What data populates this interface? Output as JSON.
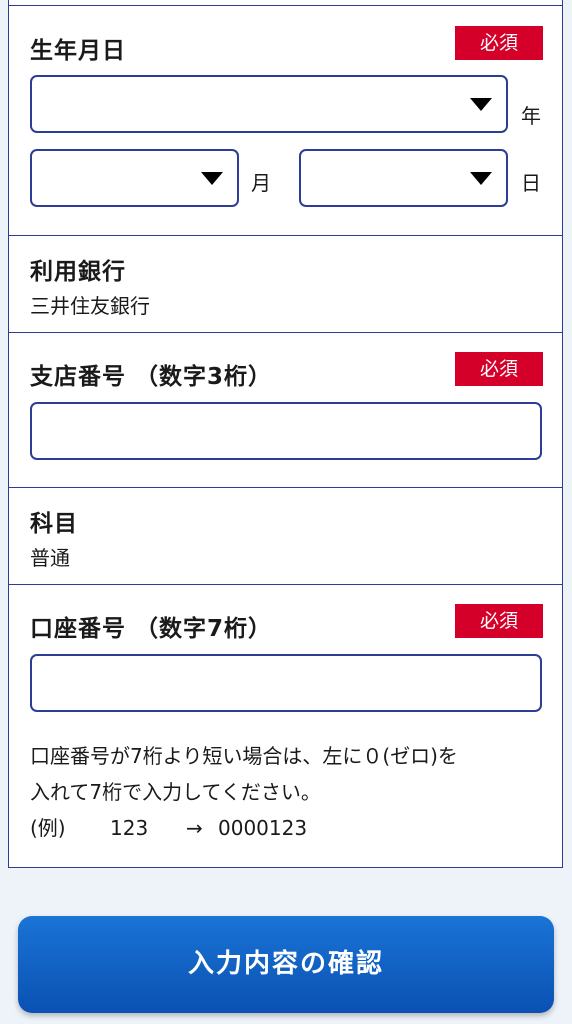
{
  "birthdate": {
    "label": "生年月日",
    "required_badge": "必須",
    "year_unit": "年",
    "month_unit": "月",
    "day_unit": "日"
  },
  "bank": {
    "label": "利用銀行",
    "value": "三井住友銀行"
  },
  "branch": {
    "label": "支店番号 （数字3桁）",
    "required_badge": "必須"
  },
  "account_type": {
    "label": "科目",
    "value": "普通"
  },
  "account_number": {
    "label": "口座番号 （数字7桁）",
    "required_badge": "必須",
    "note_line1": "口座番号が7桁より短い場合は、左に０(ゼロ)を",
    "note_line2": "入れて7桁で入力してください。",
    "example_prefix": "(例)",
    "example_value": "123",
    "example_arrow": "→",
    "example_result": "0000123"
  },
  "confirm_button": {
    "label": "入力内容の確認"
  }
}
